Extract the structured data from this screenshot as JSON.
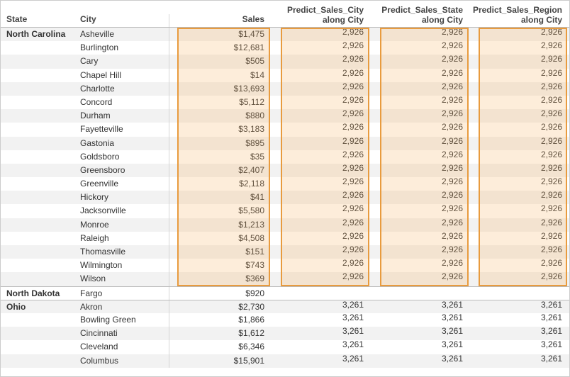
{
  "headers": {
    "state": "State",
    "city": "City",
    "sales": "Sales",
    "pred_city_l1": "Predict_Sales_City",
    "pred_city_l2": "along City",
    "pred_state_l1": "Predict_Sales_State",
    "pred_state_l2": "along City",
    "pred_region_l1": "Predict_Sales_Region",
    "pred_region_l2": "along City"
  },
  "rows": [
    {
      "state": "North Carolina",
      "city": "Asheville",
      "sales": "$1,475",
      "p1": "2,926",
      "p2": "2,926",
      "p3": "2,926",
      "zebra": true,
      "divider": false,
      "showState": true
    },
    {
      "state": "",
      "city": "Burlington",
      "sales": "$12,681",
      "p1": "2,926",
      "p2": "2,926",
      "p3": "2,926",
      "zebra": false,
      "divider": false,
      "showState": false
    },
    {
      "state": "",
      "city": "Cary",
      "sales": "$505",
      "p1": "2,926",
      "p2": "2,926",
      "p3": "2,926",
      "zebra": true,
      "divider": false,
      "showState": false
    },
    {
      "state": "",
      "city": "Chapel Hill",
      "sales": "$14",
      "p1": "2,926",
      "p2": "2,926",
      "p3": "2,926",
      "zebra": false,
      "divider": false,
      "showState": false
    },
    {
      "state": "",
      "city": "Charlotte",
      "sales": "$13,693",
      "p1": "2,926",
      "p2": "2,926",
      "p3": "2,926",
      "zebra": true,
      "divider": false,
      "showState": false
    },
    {
      "state": "",
      "city": "Concord",
      "sales": "$5,112",
      "p1": "2,926",
      "p2": "2,926",
      "p3": "2,926",
      "zebra": false,
      "divider": false,
      "showState": false
    },
    {
      "state": "",
      "city": "Durham",
      "sales": "$880",
      "p1": "2,926",
      "p2": "2,926",
      "p3": "2,926",
      "zebra": true,
      "divider": false,
      "showState": false
    },
    {
      "state": "",
      "city": "Fayetteville",
      "sales": "$3,183",
      "p1": "2,926",
      "p2": "2,926",
      "p3": "2,926",
      "zebra": false,
      "divider": false,
      "showState": false
    },
    {
      "state": "",
      "city": "Gastonia",
      "sales": "$895",
      "p1": "2,926",
      "p2": "2,926",
      "p3": "2,926",
      "zebra": true,
      "divider": false,
      "showState": false
    },
    {
      "state": "",
      "city": "Goldsboro",
      "sales": "$35",
      "p1": "2,926",
      "p2": "2,926",
      "p3": "2,926",
      "zebra": false,
      "divider": false,
      "showState": false
    },
    {
      "state": "",
      "city": "Greensboro",
      "sales": "$2,407",
      "p1": "2,926",
      "p2": "2,926",
      "p3": "2,926",
      "zebra": true,
      "divider": false,
      "showState": false
    },
    {
      "state": "",
      "city": "Greenville",
      "sales": "$2,118",
      "p1": "2,926",
      "p2": "2,926",
      "p3": "2,926",
      "zebra": false,
      "divider": false,
      "showState": false
    },
    {
      "state": "",
      "city": "Hickory",
      "sales": "$41",
      "p1": "2,926",
      "p2": "2,926",
      "p3": "2,926",
      "zebra": true,
      "divider": false,
      "showState": false
    },
    {
      "state": "",
      "city": "Jacksonville",
      "sales": "$5,580",
      "p1": "2,926",
      "p2": "2,926",
      "p3": "2,926",
      "zebra": false,
      "divider": false,
      "showState": false
    },
    {
      "state": "",
      "city": "Monroe",
      "sales": "$1,213",
      "p1": "2,926",
      "p2": "2,926",
      "p3": "2,926",
      "zebra": true,
      "divider": false,
      "showState": false
    },
    {
      "state": "",
      "city": "Raleigh",
      "sales": "$4,508",
      "p1": "2,926",
      "p2": "2,926",
      "p3": "2,926",
      "zebra": false,
      "divider": false,
      "showState": false
    },
    {
      "state": "",
      "city": "Thomasville",
      "sales": "$151",
      "p1": "2,926",
      "p2": "2,926",
      "p3": "2,926",
      "zebra": true,
      "divider": false,
      "showState": false
    },
    {
      "state": "",
      "city": "Wilmington",
      "sales": "$743",
      "p1": "2,926",
      "p2": "2,926",
      "p3": "2,926",
      "zebra": false,
      "divider": false,
      "showState": false
    },
    {
      "state": "",
      "city": "Wilson",
      "sales": "$369",
      "p1": "2,926",
      "p2": "2,926",
      "p3": "2,926",
      "zebra": true,
      "divider": false,
      "showState": false
    },
    {
      "state": "North Dakota",
      "city": "Fargo",
      "sales": "$920",
      "p1": "",
      "p2": "",
      "p3": "",
      "zebra": false,
      "divider": true,
      "showState": true
    },
    {
      "state": "Ohio",
      "city": "Akron",
      "sales": "$2,730",
      "p1": "3,261",
      "p2": "3,261",
      "p3": "3,261",
      "zebra": true,
      "divider": true,
      "showState": true
    },
    {
      "state": "",
      "city": "Bowling Green",
      "sales": "$1,866",
      "p1": "3,261",
      "p2": "3,261",
      "p3": "3,261",
      "zebra": false,
      "divider": false,
      "showState": false
    },
    {
      "state": "",
      "city": "Cincinnati",
      "sales": "$1,612",
      "p1": "3,261",
      "p2": "3,261",
      "p3": "3,261",
      "zebra": true,
      "divider": false,
      "showState": false
    },
    {
      "state": "",
      "city": "Cleveland",
      "sales": "$6,346",
      "p1": "3,261",
      "p2": "3,261",
      "p3": "3,261",
      "zebra": false,
      "divider": false,
      "showState": false
    },
    {
      "state": "",
      "city": "Columbus",
      "sales": "$15,901",
      "p1": "3,261",
      "p2": "3,261",
      "p3": "3,261",
      "zebra": true,
      "divider": false,
      "showState": false
    }
  ],
  "chart_data": {
    "type": "table",
    "title": "",
    "columns": [
      "State",
      "City",
      "Sales",
      "Predict_Sales_City along City",
      "Predict_Sales_State along City",
      "Predict_Sales_Region along City"
    ],
    "rows": [
      [
        "North Carolina",
        "Asheville",
        1475,
        2926,
        2926,
        2926
      ],
      [
        "North Carolina",
        "Burlington",
        12681,
        2926,
        2926,
        2926
      ],
      [
        "North Carolina",
        "Cary",
        505,
        2926,
        2926,
        2926
      ],
      [
        "North Carolina",
        "Chapel Hill",
        14,
        2926,
        2926,
        2926
      ],
      [
        "North Carolina",
        "Charlotte",
        13693,
        2926,
        2926,
        2926
      ],
      [
        "North Carolina",
        "Concord",
        5112,
        2926,
        2926,
        2926
      ],
      [
        "North Carolina",
        "Durham",
        880,
        2926,
        2926,
        2926
      ],
      [
        "North Carolina",
        "Fayetteville",
        3183,
        2926,
        2926,
        2926
      ],
      [
        "North Carolina",
        "Gastonia",
        895,
        2926,
        2926,
        2926
      ],
      [
        "North Carolina",
        "Goldsboro",
        35,
        2926,
        2926,
        2926
      ],
      [
        "North Carolina",
        "Greensboro",
        2407,
        2926,
        2926,
        2926
      ],
      [
        "North Carolina",
        "Greenville",
        2118,
        2926,
        2926,
        2926
      ],
      [
        "North Carolina",
        "Hickory",
        41,
        2926,
        2926,
        2926
      ],
      [
        "North Carolina",
        "Jacksonville",
        5580,
        2926,
        2926,
        2926
      ],
      [
        "North Carolina",
        "Monroe",
        1213,
        2926,
        2926,
        2926
      ],
      [
        "North Carolina",
        "Raleigh",
        4508,
        2926,
        2926,
        2926
      ],
      [
        "North Carolina",
        "Thomasville",
        151,
        2926,
        2926,
        2926
      ],
      [
        "North Carolina",
        "Wilmington",
        743,
        2926,
        2926,
        2926
      ],
      [
        "North Carolina",
        "Wilson",
        369,
        2926,
        2926,
        2926
      ],
      [
        "North Dakota",
        "Fargo",
        920,
        null,
        null,
        null
      ],
      [
        "Ohio",
        "Akron",
        2730,
        3261,
        3261,
        3261
      ],
      [
        "Ohio",
        "Bowling Green",
        1866,
        3261,
        3261,
        3261
      ],
      [
        "Ohio",
        "Cincinnati",
        1612,
        3261,
        3261,
        3261
      ],
      [
        "Ohio",
        "Cleveland",
        6346,
        3261,
        3261,
        3261
      ],
      [
        "Ohio",
        "Columbus",
        15901,
        3261,
        3261,
        3261
      ]
    ]
  }
}
